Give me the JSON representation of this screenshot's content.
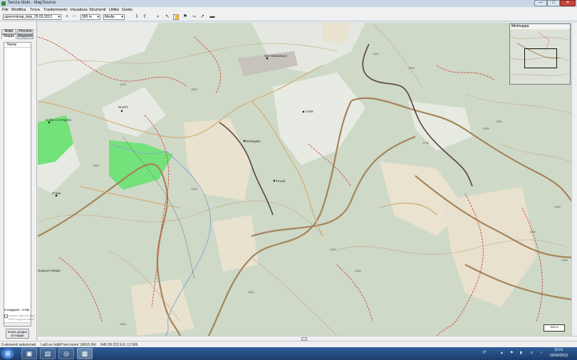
{
  "window": {
    "title": "Senza titolo - MapSource",
    "min_glyph": "—",
    "max_glyph": "□",
    "close_glyph": "✕"
  },
  "menu": [
    "File",
    "Modifica",
    "Trova",
    "Trasferimento",
    "Visualizza",
    "Strumenti",
    "Utilità",
    "Guida"
  ],
  "toolbar": {
    "map_product": "oprecmimap_italy_29.03.2013",
    "zoom_level": "300 m",
    "detail": "Medio"
  },
  "left_panel": {
    "tabs_row1": [
      "Rotte",
      "Percorsi"
    ],
    "tabs_row2": [
      "Mappe",
      "Waypoint"
    ],
    "column_header": "Nome",
    "map_count": "0 mappa/e - 0 KB",
    "checkbox_label": "Includi i dati del disp. GPS supporti vettori",
    "group_button": "Nome gruppo di mappe"
  },
  "minimap": {
    "title": "Minimappa"
  },
  "map": {
    "places": [
      "Nocchi",
      "Costa Ci Gregorio",
      "San Sebastiano",
      "Casa",
      "Derbugian",
      "Trovoli",
      "Crupa",
      "Guisseri Pettole"
    ],
    "elevations": [
      "1200",
      "1400",
      "1300",
      "1500",
      "1100",
      "1000",
      "1300",
      "1200",
      "1400",
      "1100",
      "1300",
      "1100",
      "1300",
      "1200",
      "1300",
      "1300"
    ],
    "scale_label": "300 m"
  },
  "status": {
    "selection": "0 elementi selezionati",
    "coords_format": "Lat/Lon hddd°mm.mmm' (WGS 84)",
    "coords_value": "N45 55.232 E11 12.566"
  },
  "taskbar": {
    "start_glyph": "⊞",
    "language": "IT",
    "time": "15:01",
    "date": "03/04/2013"
  },
  "colors": {
    "map_background": "#ced9c8",
    "contour_brown": "#a6845a",
    "trail_red": "#d2463c",
    "forest_green": "#66dd66",
    "track_dark": "#5a4440"
  }
}
